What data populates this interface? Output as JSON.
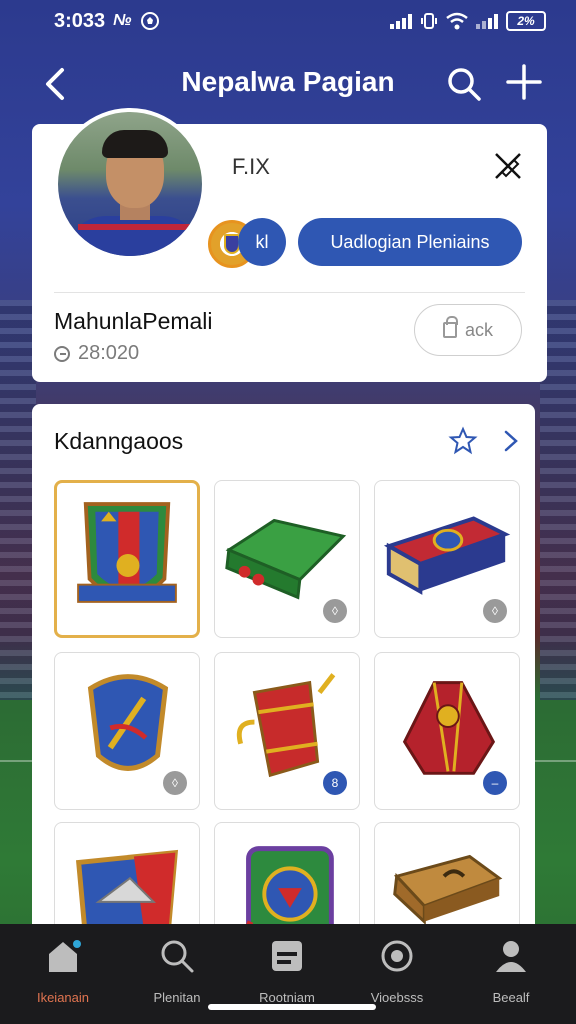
{
  "status_bar": {
    "time": "3:033",
    "app_glyph": "№",
    "battery": "2%"
  },
  "app_bar": {
    "title": "Nepalwa Pagian",
    "back_icon": "back-arrow-icon",
    "search_icon": "search-icon",
    "add_icon": "plus-icon"
  },
  "profile": {
    "tag": "F.IX",
    "small_button": "kl",
    "main_button": "Uadlogian Pleniains",
    "name": "MahunlaPemali",
    "meta": "28:020",
    "ask_button": "ack"
  },
  "collection": {
    "title": "Kdanngaoos",
    "items": [
      {
        "name": "shield-crest",
        "selected": true,
        "corner": ""
      },
      {
        "name": "green-wallet",
        "selected": false,
        "corner": "◊"
      },
      {
        "name": "red-book",
        "selected": false,
        "corner": "◊"
      },
      {
        "name": "blue-shield",
        "selected": false,
        "corner": "◊"
      },
      {
        "name": "red-horn",
        "selected": false,
        "corner": "8"
      },
      {
        "name": "red-cape",
        "selected": false,
        "corner": "–"
      },
      {
        "name": "badge-pennant",
        "selected": false,
        "corner": ""
      },
      {
        "name": "green-emblem",
        "selected": false,
        "corner": ""
      },
      {
        "name": "brown-scroll",
        "selected": false,
        "corner": ""
      }
    ]
  },
  "bottom_nav": {
    "items": [
      {
        "label": "Ikeianain",
        "icon": "home-icon",
        "active": true
      },
      {
        "label": "Plenitan",
        "icon": "search-icon",
        "active": false
      },
      {
        "label": "Rootniam",
        "icon": "card-icon",
        "active": false
      },
      {
        "label": "Vioebsss",
        "icon": "ball-icon",
        "active": false
      },
      {
        "label": "Beealf",
        "icon": "person-icon",
        "active": false
      }
    ]
  },
  "colors": {
    "accent": "#2f57b3",
    "active_nav": "#e07450",
    "selected_border": "#e3b04a"
  }
}
